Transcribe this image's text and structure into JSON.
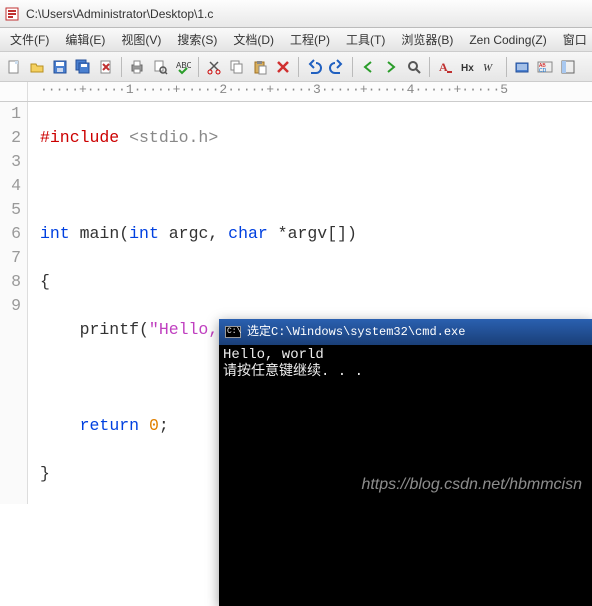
{
  "title": "C:\\Users\\Administrator\\Desktop\\1.c",
  "menu": {
    "file": "文件(F)",
    "edit": "编辑(E)",
    "view": "视图(V)",
    "search": "搜索(S)",
    "document": "文档(D)",
    "project": "工程(P)",
    "tools": "工具(T)",
    "browser": "浏览器(B)",
    "zen": "Zen Coding(Z)",
    "window": "窗口"
  },
  "toolbar_icons": {
    "new": "new-file-icon",
    "open": "open-folder-icon",
    "save": "save-icon",
    "saveall": "save-all-icon",
    "close": "close-file-icon",
    "print": "print-icon",
    "preview": "print-preview-icon",
    "cut": "cut-icon",
    "copy": "copy-icon",
    "paste": "paste-icon",
    "delete": "delete-icon",
    "undo": "undo-icon",
    "redo": "redo-icon",
    "nav1": "nav-back-icon",
    "nav2": "nav-fwd-icon",
    "find": "find-icon",
    "font": "font-icon",
    "hex": "hex-icon",
    "wrap": "word-wrap-icon",
    "compile": "compile-icon",
    "charset": "charset-icon",
    "panel": "panel-icon"
  },
  "ruler": "·····+·····1·····+·····2·····+·····3·····+·····4·····+·····5",
  "code": {
    "lines": [
      "1",
      "2",
      "3",
      "4",
      "5",
      "6",
      "7",
      "8",
      "9"
    ],
    "l1_a": "#include",
    "l1_b": "<stdio.h>",
    "l3_int": "int",
    "l3_main": " main(",
    "l3_int2": "int",
    "l3_argc": " argc, ",
    "l3_char": "char",
    "l3_argv": " *argv[])",
    "l4": "{",
    "l5_pre": "    printf(",
    "l5_str": "\"Hello, world\\n\"",
    "l5_post": ");",
    "l7_pre": "    ",
    "l7_ret": "return",
    "l7_sp": " ",
    "l7_num": "0",
    "l7_post": ";",
    "l8": "}"
  },
  "console": {
    "title_prefix": "选定 ",
    "title_path": "C:\\Windows\\system32\\cmd.exe",
    "out_line1": "Hello, world",
    "out_line2": "请按任意键继续. . ."
  },
  "watermark": "https://blog.csdn.net/hbmmcisn"
}
